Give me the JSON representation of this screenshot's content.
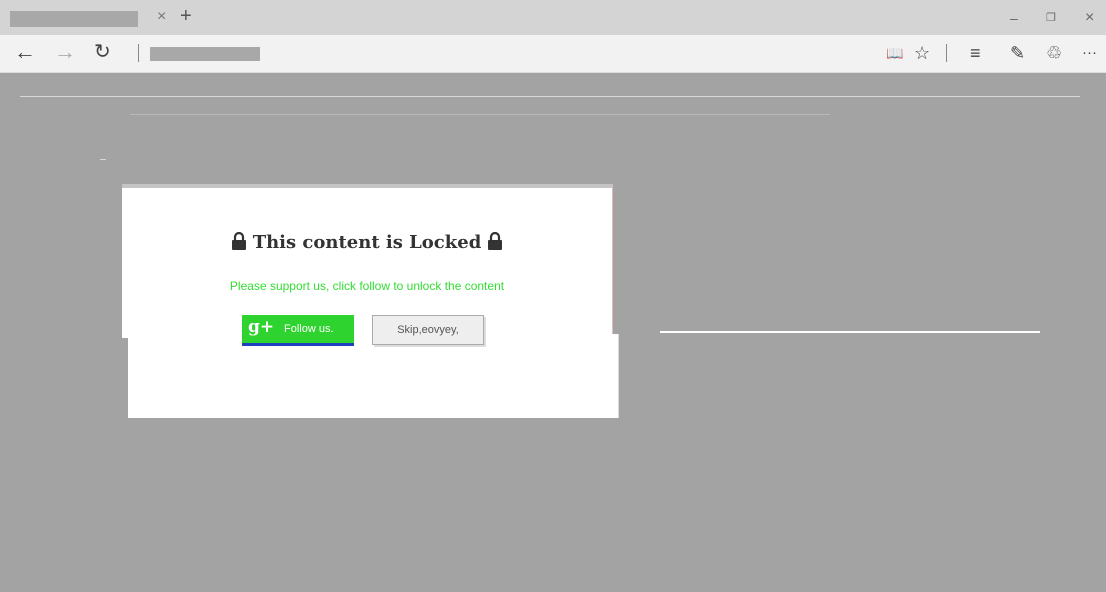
{
  "browser": {
    "tab_close_glyph": "×",
    "new_tab_glyph": "+",
    "window_controls": {
      "minimize": "–",
      "restore": "❐",
      "close": "×"
    },
    "nav": {
      "back": "←",
      "forward": "→",
      "refresh": "↻"
    },
    "toolbar_icons": {
      "reading_view": "📖",
      "favorite": "☆",
      "hub": "≡",
      "web_note": "✎",
      "share": "♲",
      "more": "···"
    }
  },
  "modal": {
    "title": "This content is Locked",
    "subtitle": "Please support us, click follow to unlock the content",
    "follow_label": "Follow us.",
    "gplus_glyph": "g+",
    "skip_label": "Skip,eovyey,",
    "follow_color": "#2fd32f",
    "subtitle_color": "#33dd33"
  }
}
